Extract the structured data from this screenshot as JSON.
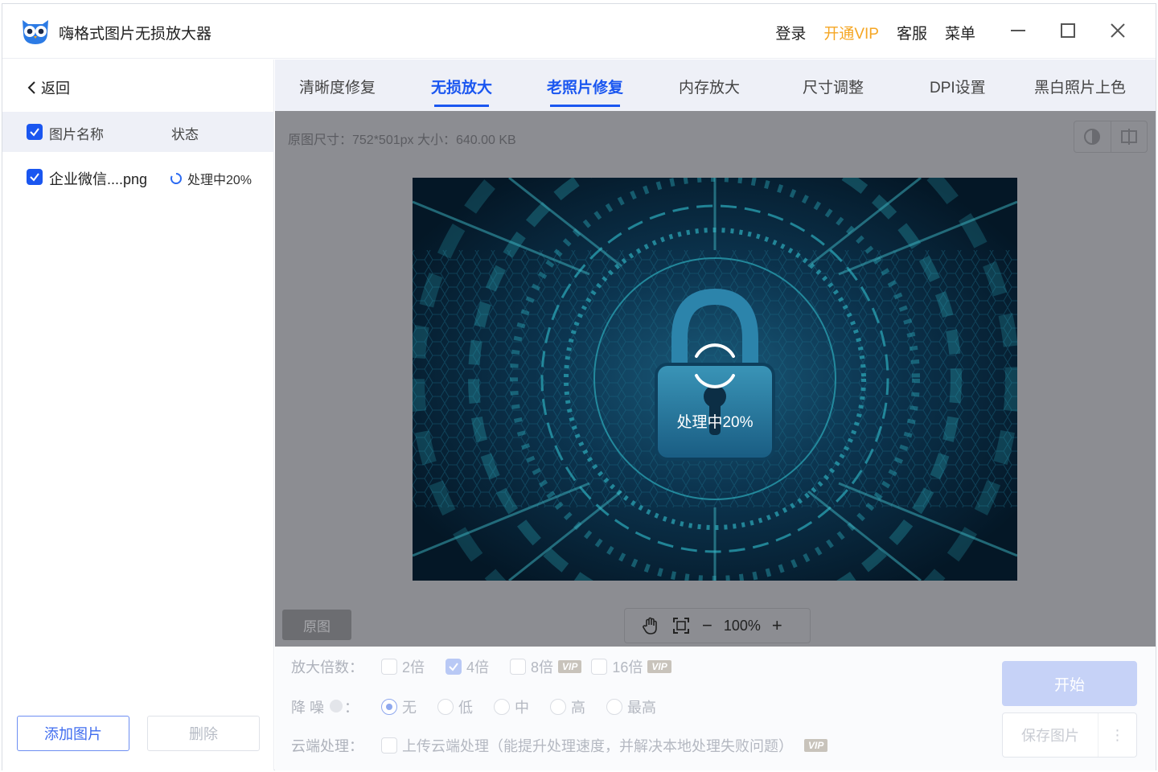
{
  "app": {
    "title": "嗨格式图片无损放大器",
    "links": {
      "login": "登录",
      "vip": "开通VIP",
      "service": "客服",
      "menu": "菜单"
    }
  },
  "sidebar": {
    "back_label": "返回",
    "header": {
      "name": "图片名称",
      "status": "状态"
    },
    "files": [
      {
        "name": "企业微信....png",
        "status": "处理中20%"
      }
    ],
    "add_label": "添加图片",
    "delete_label": "删除"
  },
  "tabs": [
    {
      "label": "清晰度修复"
    },
    {
      "label": "无损放大",
      "active": true
    },
    {
      "label": "老照片修复"
    },
    {
      "label": "内存放大"
    },
    {
      "label": "尺寸调整"
    },
    {
      "label": "DPI设置"
    },
    {
      "label": "黑白照片上色"
    }
  ],
  "preview": {
    "info": "原图尺寸：752*501px   大小：640.00 KB",
    "progress_text": "处理中20%",
    "progress_fraction": 0.2,
    "original_label": "原图",
    "zoom_value": "100%",
    "zoom_minus": "−",
    "zoom_plus": "+"
  },
  "settings": {
    "scale": {
      "label": "放大倍数：",
      "options": [
        "2倍",
        "4倍",
        "8倍",
        "16倍"
      ],
      "selected": "4倍",
      "vip_badge": "VIP"
    },
    "denoise": {
      "label_a": "降 噪",
      "label_b": "：",
      "options": [
        "无",
        "低",
        "中",
        "高",
        "最高"
      ],
      "selected": "无"
    },
    "cloud": {
      "label": "云端处理：",
      "option": "上传云端处理（能提升处理速度，并解决本地处理失败问题）",
      "vip_badge": "VIP"
    },
    "start_label": "开始",
    "save_label": "保存图片",
    "more_label": "⋮"
  },
  "colors": {
    "accent": "#1a56f0",
    "vip": "#f5a623"
  }
}
